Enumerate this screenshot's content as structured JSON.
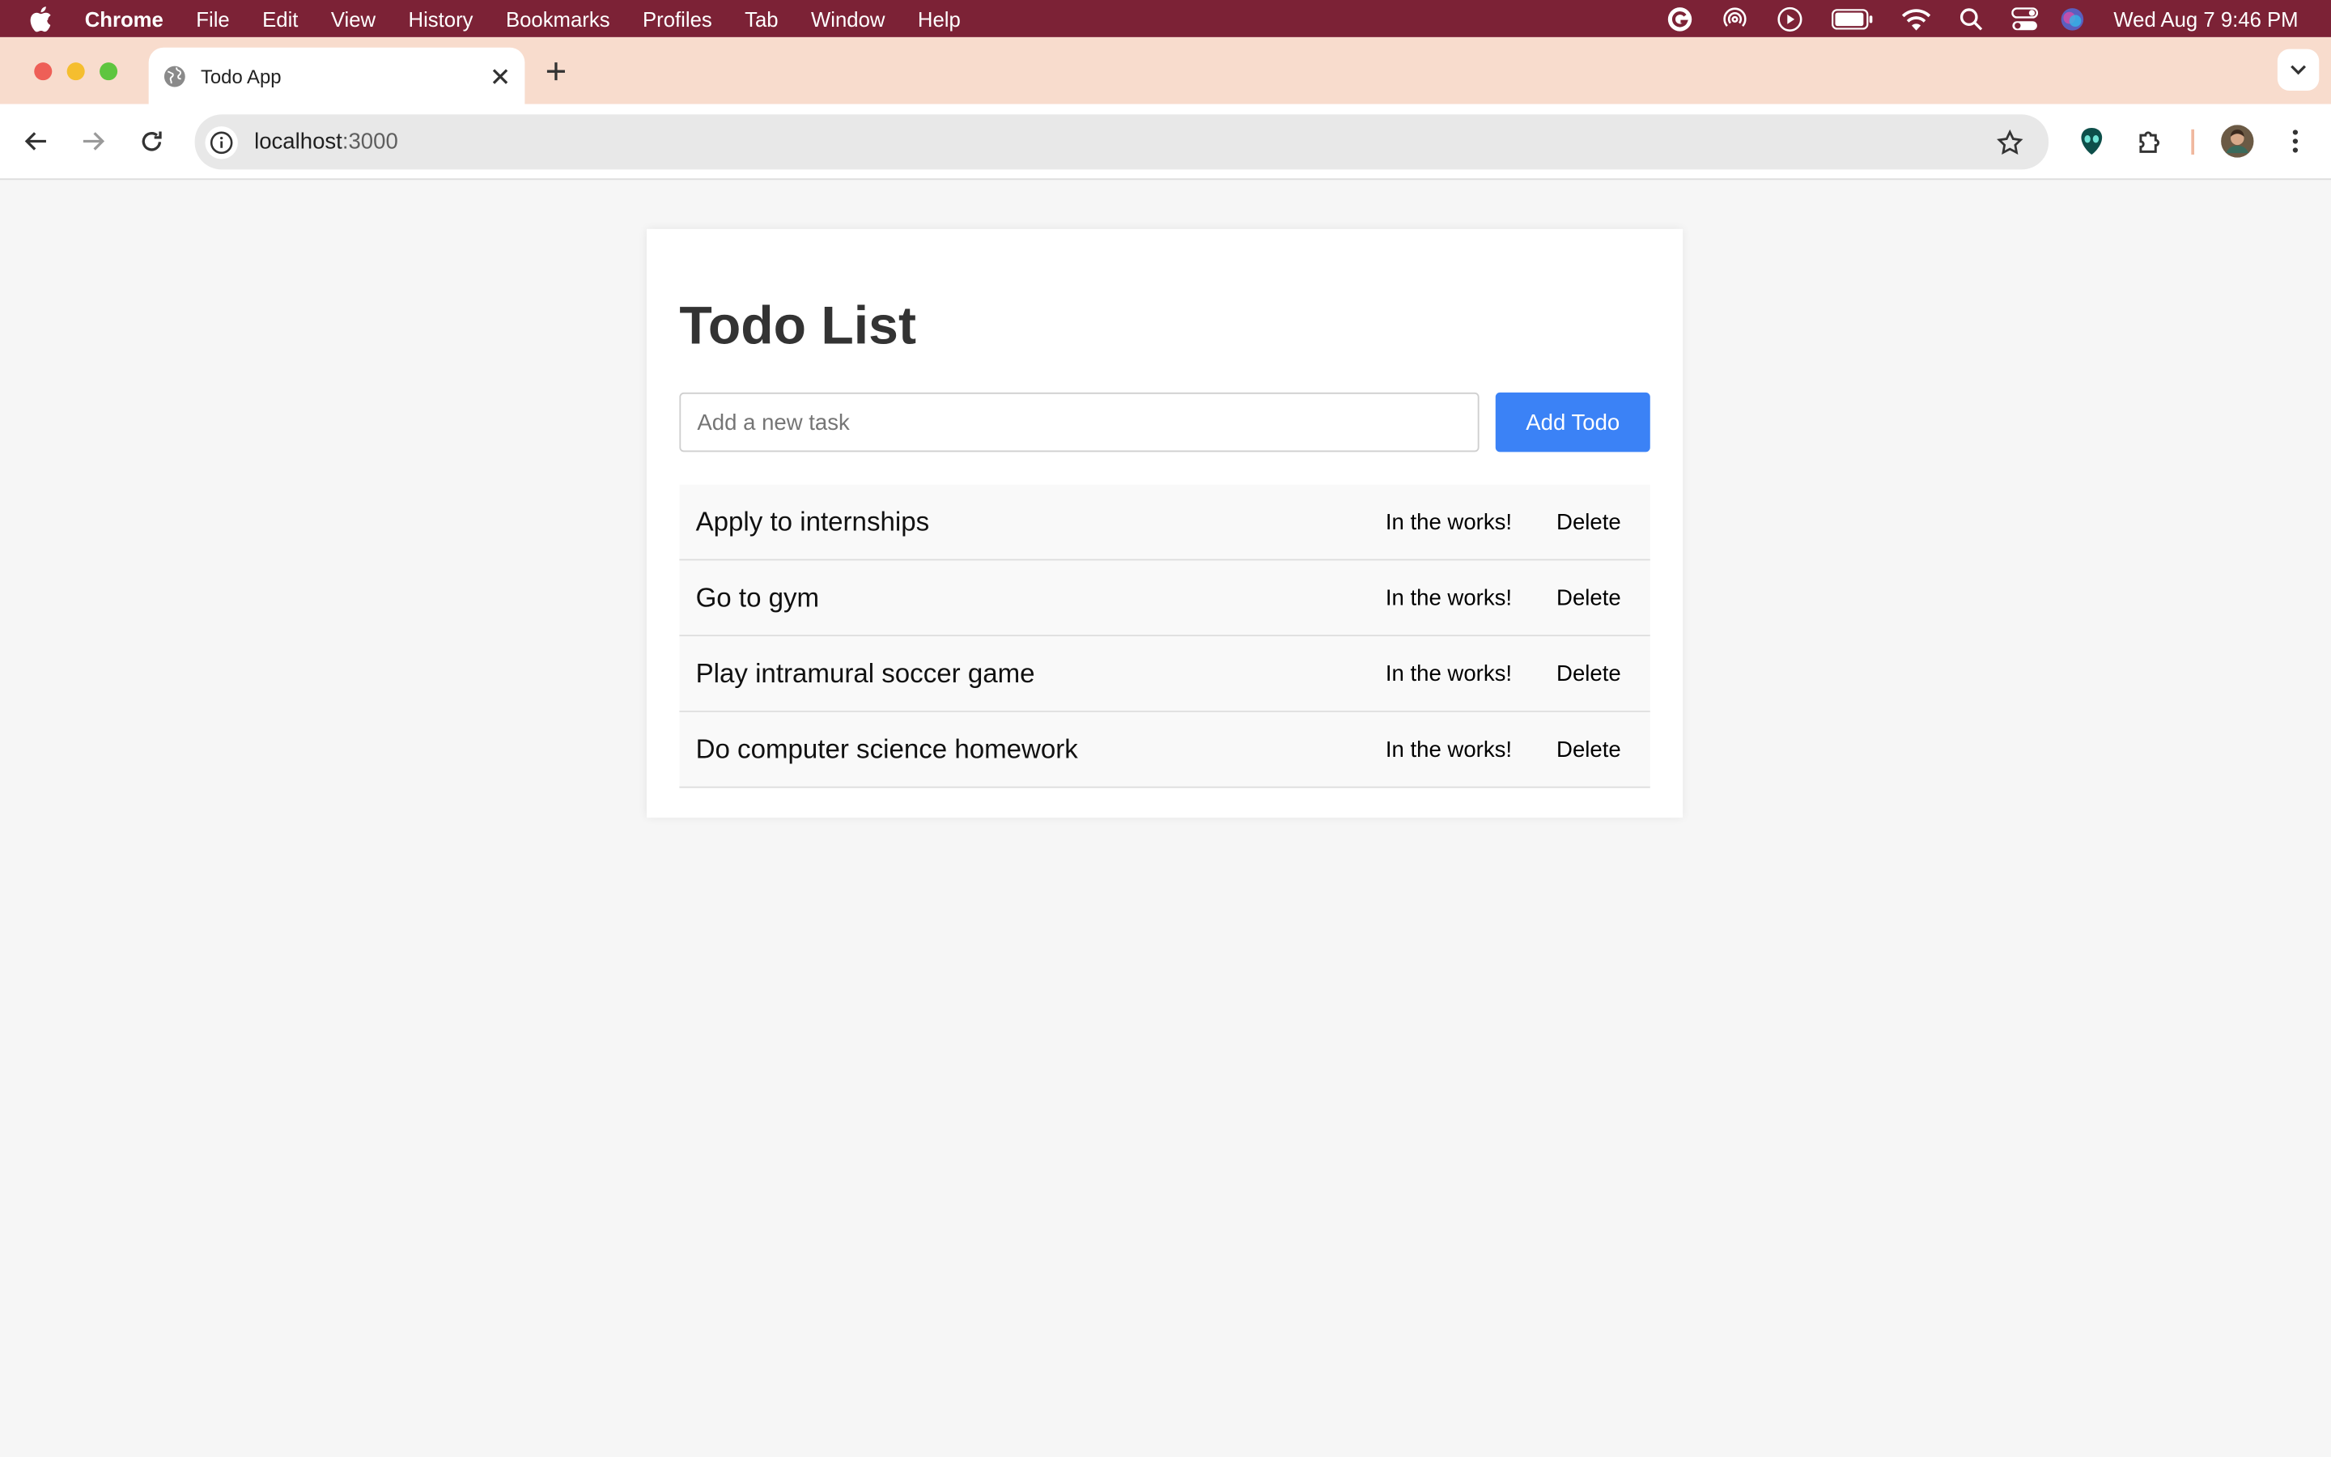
{
  "menubar": {
    "app_name": "Chrome",
    "items": [
      "File",
      "Edit",
      "View",
      "History",
      "Bookmarks",
      "Profiles",
      "Tab",
      "Window",
      "Help"
    ],
    "clock": "Wed Aug 7  9:46 PM"
  },
  "browser": {
    "tab_title": "Todo App",
    "url_host": "localhost",
    "url_port": ":3000"
  },
  "app": {
    "title": "Todo List",
    "input_placeholder": "Add a new task",
    "add_button_label": "Add Todo",
    "todos": [
      {
        "text": "Apply to internships",
        "status_label": "In the works!",
        "delete_label": "Delete"
      },
      {
        "text": "Go to gym",
        "status_label": "In the works!",
        "delete_label": "Delete"
      },
      {
        "text": "Play intramural soccer game",
        "status_label": "In the works!",
        "delete_label": "Delete"
      },
      {
        "text": "Do computer science homework",
        "status_label": "In the works!",
        "delete_label": "Delete"
      }
    ]
  },
  "colors": {
    "menubar_bg": "#7c2236",
    "tabstrip_bg": "#f8dccd",
    "accent_button": "#3b82f6",
    "page_bg": "#f6f6f6"
  },
  "icons": {
    "menubar_status": [
      "grammarly-icon",
      "airdrop-icon",
      "play-icon",
      "battery-icon",
      "wifi-icon",
      "spotlight-search-icon",
      "control-center-icon",
      "siri-icon"
    ]
  }
}
